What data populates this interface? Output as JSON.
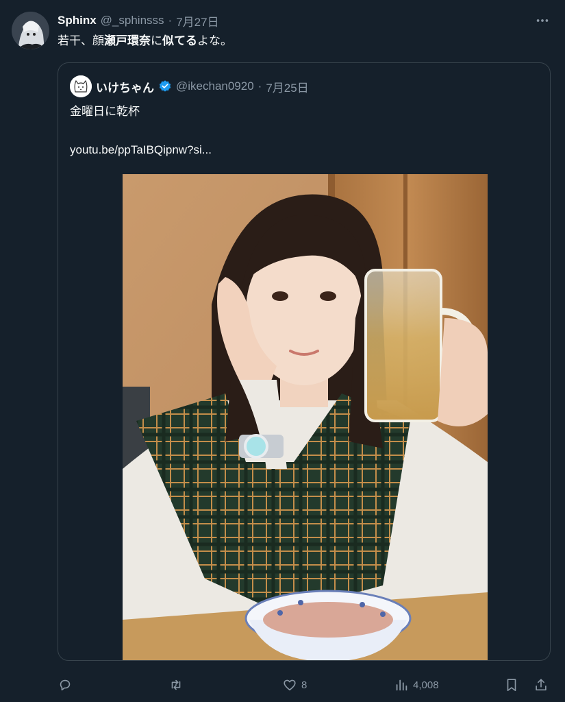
{
  "tweet": {
    "display_name": "Sphinx",
    "handle": "@_sphinsss",
    "separator": "·",
    "date": "7月27日",
    "text_segments": [
      "若干、顔",
      "瀬戸環奈",
      "に",
      "似てる",
      "よな。"
    ]
  },
  "quoted": {
    "display_name": "いけちゃん",
    "handle": "@ikechan0920",
    "separator": "·",
    "date": "7月25日",
    "text": "金曜日に乾杯",
    "link": "youtu.be/ppTaIBQipnw?si..."
  },
  "actions": {
    "reply_count": "",
    "retweet_count": "",
    "like_count": "8",
    "view_count": "4,008"
  },
  "icons": {
    "more": "more-horizontal-icon",
    "verified": "verified-badge-icon",
    "reply": "reply-icon",
    "retweet": "retweet-icon",
    "like": "heart-icon",
    "views": "analytics-icon",
    "bookmark": "bookmark-icon",
    "share": "share-icon"
  },
  "colors": {
    "background": "#15202b",
    "text": "#f7f9f9",
    "muted": "#8b98a5",
    "border": "#38444d",
    "verified": "#1d9bf0"
  }
}
